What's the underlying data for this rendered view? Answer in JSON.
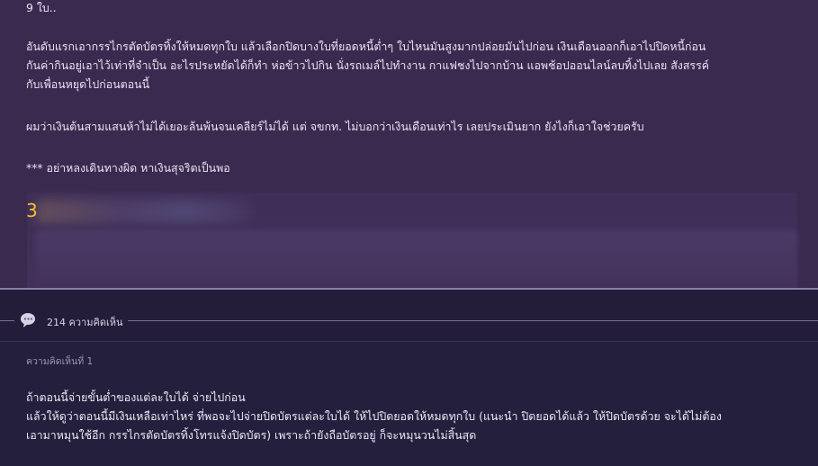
{
  "post": {
    "line_top": "9 ใบ..",
    "paragraph1": [
      "อันดับแรกเอากรรไกรตัดบัตรทิ้งให้หมดทุกใบ แล้วเลือกปิดบางใบที่ยอดหนี้ต่ำๆ ใบไหนมันสูงมากปล่อยมันไปก่อน เงินเดือนออกก็เอาไปปิดหนี้ก่อน",
      "กันค่ากินอยู่เอาไว้เท่าที่จำเป็น อะไรประหยัดได้ก็ทำ ห่อข้าวไปกิน นั่งรถเมล์ไปทำงาน กาแฟชงไปจากบ้าน แอพช้อปออนไลน์ลบทิ้งไปเลย สังสรรค์",
      "กับเพื่อนหยุดไปก่อนตอนนี้"
    ],
    "paragraph2": "ผมว่าเงินต้นสามแสนห้าไม่ได้เยอะล้นพ้นจนเคลียร์ไม่ได้ แต่ จขกท. ไม่บอกว่าเงินเดือนเท่าไร เลยประเมินยาก ยังไงก็เอาใจช่วยครับ",
    "paragraph3": "*** อย่าหลงเดินทางผิด หาเงินสุจริตเป็นพอ",
    "blurred_number": "3"
  },
  "comments_bar": {
    "count_label": "214 ความคิดเห็น",
    "icon": "chat-bubble-icon"
  },
  "comment": {
    "label": "ความคิดเห็นที่ 1",
    "lines": [
      "ถ้าตอนนี้จ่ายขั้นต่ำของแต่ละใบได้ จ่ายไปก่อน",
      "แล้วให้ดูว่าตอนนี้มีเงินเหลือเท่าไหร่ ที่พอจะไปจ่ายปิดบัตรแต่ละใบได้ ให้ไปปิดยอดให้หมดทุกใบ (แนะนำ ปิดยอดได้แล้ว ให้ปิดบัตรด้วย จะได้ไม่ต้อง",
      "เอามาหมุนใช้อีก กรรไกรตัดบัตรทิ้งโทรแจ้งปิดบัตร) เพราะถ้ายังถือบัตรอยู่ ก็จะหมุนวนไม่สิ้นสุด"
    ]
  },
  "colors": {
    "post_bg": "#3b2a4f",
    "comment_bg": "#231f3d",
    "accent_number": "#f2c230"
  }
}
